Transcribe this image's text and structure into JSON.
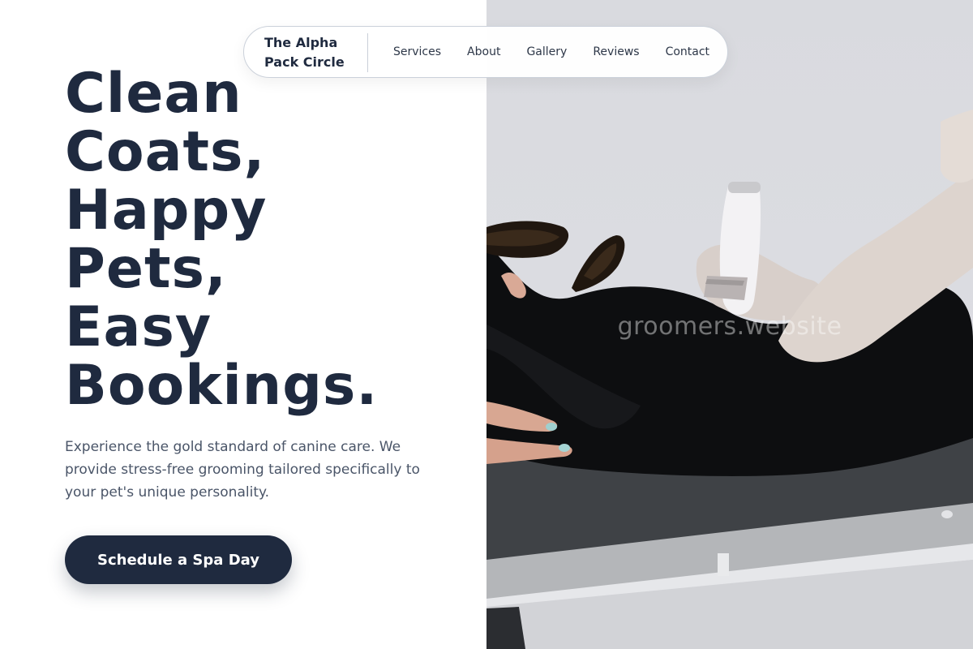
{
  "nav": {
    "brand_line1": "The Alpha",
    "brand_line2": "Pack Circle",
    "links": [
      {
        "label": "Services"
      },
      {
        "label": "About"
      },
      {
        "label": "Gallery"
      },
      {
        "label": "Reviews"
      },
      {
        "label": "Contact"
      }
    ]
  },
  "hero": {
    "headline_lines": [
      "Clean",
      "Coats,",
      "Happy",
      "Pets,",
      "Easy",
      "Bookings."
    ],
    "subtext": "Experience the gold standard of canine care. We provide stress-free grooming tailored specifically to your pet's unique personality.",
    "cta_label": "Schedule a Spa Day",
    "photo_watermark": "groomers.website"
  },
  "colors": {
    "primary": "#1f2a3f",
    "body_text": "#4a5568",
    "nav_border": "#cbd1da",
    "background": "#ffffff"
  }
}
